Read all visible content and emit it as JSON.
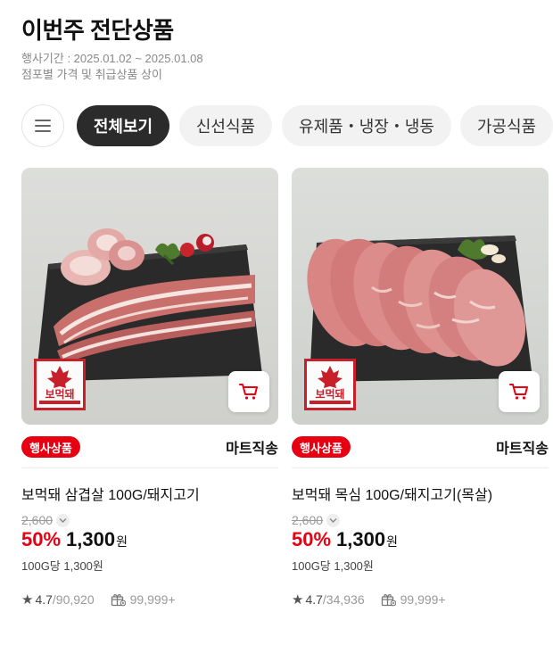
{
  "header": {
    "title": "이번주 전단상품",
    "period": "행사기간 : 2025.01.02 ~ 2025.01.08",
    "notice": "점포별 가격 및 취급상품 상이"
  },
  "categories": {
    "menu_icon": "hamburger-menu-icon",
    "items": [
      {
        "label": "전체보기",
        "active": true
      },
      {
        "label": "신선식품",
        "active": false
      },
      {
        "label": "유제품・냉장・냉동",
        "active": false
      },
      {
        "label": "가공식품",
        "active": false
      }
    ]
  },
  "colors": {
    "accent_red": "#e60012",
    "active_chip": "#2b2b2b",
    "chip_bg": "#f2f2f2"
  },
  "products": [
    {
      "badge": "행사상품",
      "shipping": "마트직송",
      "name": "보먹돼 삼겹살 100G/돼지고기",
      "original_price": "2,600",
      "discount_rate": "50%",
      "sale_price": "1,300",
      "currency": "원",
      "unit_price": "100G당 1,300원",
      "rating": "4.7",
      "reviews": "/90,920",
      "gift_count": "99,999+",
      "brand_logo": "보먹돼",
      "image_icon": "pork-belly-image"
    },
    {
      "badge": "행사상품",
      "shipping": "마트직송",
      "name": "보먹돼 목심 100G/돼지고기(목살)",
      "original_price": "2,600",
      "discount_rate": "50%",
      "sale_price": "1,300",
      "currency": "원",
      "unit_price": "100G당 1,300원",
      "rating": "4.7",
      "reviews": "/34,936",
      "gift_count": "99,999+",
      "brand_logo": "보먹돼",
      "image_icon": "pork-neck-image"
    }
  ]
}
